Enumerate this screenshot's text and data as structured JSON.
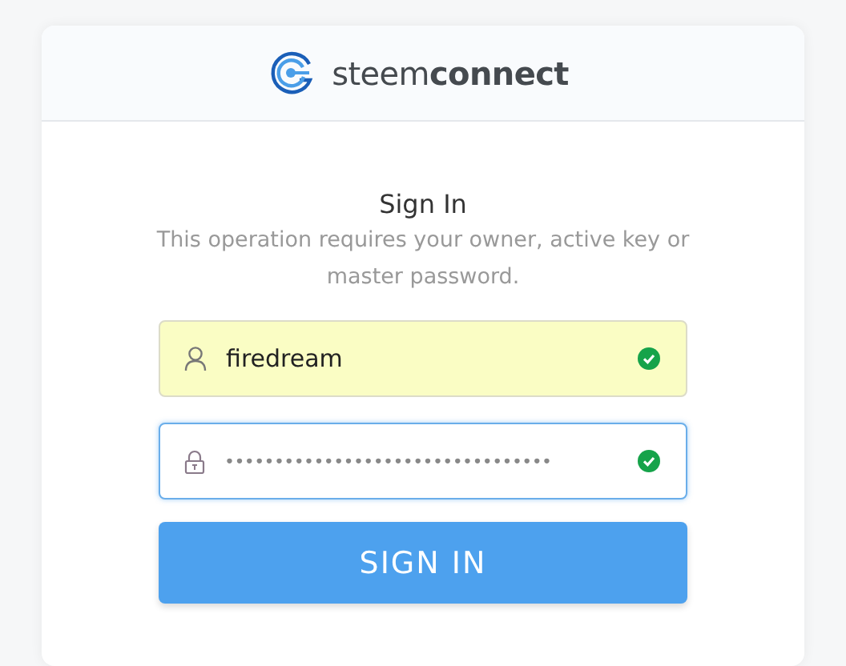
{
  "header": {
    "brand": "steem**connect**"
  },
  "form": {
    "title": "Sign In",
    "description": "This operation requires your owner, active key or master password.",
    "fields": [
      {
        "kind": "username",
        "value": "firedream",
        "valid": true,
        "autofilled": true,
        "focused": false
      },
      {
        "kind": "password",
        "value": "•••••••••••••••••••••••••••••••••",
        "valid": true,
        "autofilled": false,
        "focused": true
      }
    ],
    "submit": "SIGN IN"
  }
}
